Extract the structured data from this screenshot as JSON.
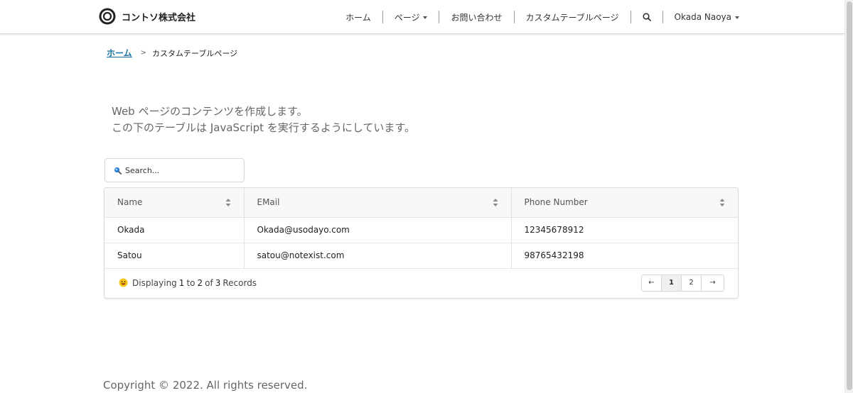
{
  "brand": {
    "name": "コントソ株式会社"
  },
  "nav": {
    "home": "ホーム",
    "pages": "ページ",
    "contact": "お問い合わせ",
    "custom_table": "カスタムテーブルページ",
    "user": "Okada Naoya"
  },
  "breadcrumb": {
    "home": "ホーム",
    "separator": ">",
    "current": "カスタムテーブルページ"
  },
  "intro": {
    "line1": "Web ページのコンテンツを作成します。",
    "line2": "この下のテーブルは JavaScript を実行するようにしています。"
  },
  "search": {
    "placeholder": "Search..."
  },
  "table": {
    "headers": {
      "name": "Name",
      "email": "EMail",
      "phone": "Phone Number"
    },
    "rows": [
      {
        "name": "Okada",
        "email": "Okada@usodayo.com",
        "phone": "12345678912"
      },
      {
        "name": "Satou",
        "email": "satou@notexist.com",
        "phone": "98765432198"
      }
    ],
    "footer": {
      "prefix": "Displaying",
      "from": "1",
      "to_word": "to",
      "to": "2",
      "of_word": "of",
      "total": "3",
      "suffix": "Records"
    },
    "pagination": {
      "prev": "←",
      "pages": [
        "1",
        "2"
      ],
      "next": "→",
      "current_page": "1"
    }
  },
  "copyright": "Copyright © 2022. All rights reserved.",
  "colors": {
    "link": "#1a73a8",
    "search_icon": "#2a7fd4",
    "smiley": "#f5c518"
  },
  "icons": {
    "logo": "ring-logo-icon",
    "search": "search-icon",
    "sort": "sort-icon",
    "smiley": "smiley-icon"
  }
}
